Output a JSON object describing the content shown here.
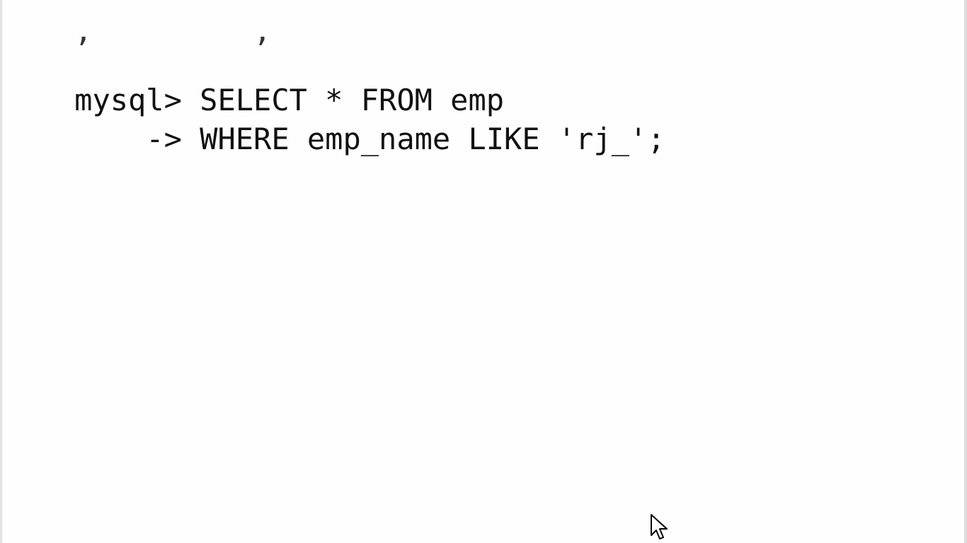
{
  "terminal": {
    "partial_top_line": ",         ,",
    "lines": [
      {
        "prompt": "mysql> ",
        "command": "SELECT * FROM emp"
      },
      {
        "prompt": "    -> ",
        "command": "WHERE emp_name LIKE 'rj_';"
      }
    ]
  },
  "pointer": {
    "icon": "mouse-pointer-icon"
  }
}
